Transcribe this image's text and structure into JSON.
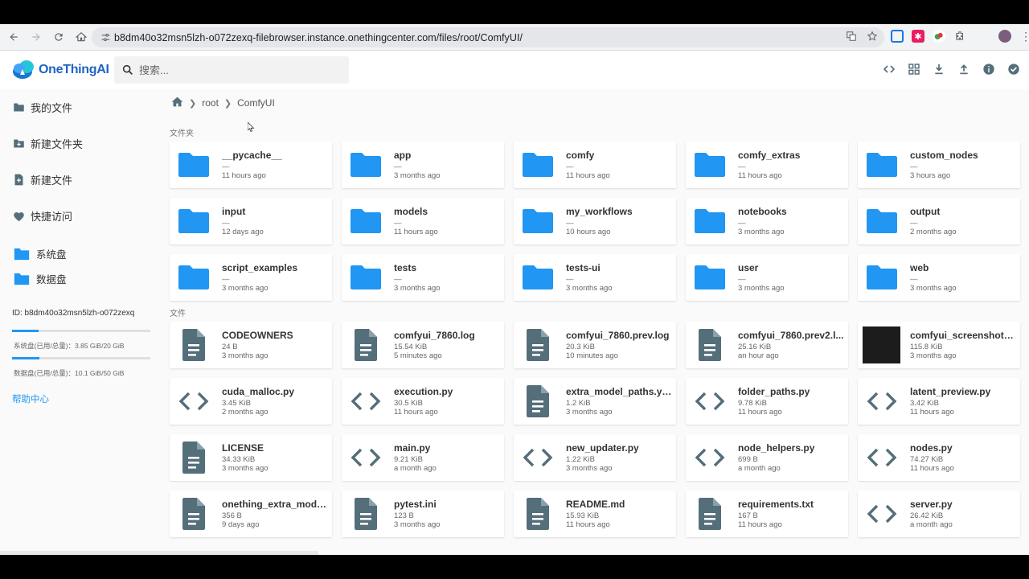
{
  "browser": {
    "url": "b8dm40o32msn5lzh-o072zexq-filebrowser.instance.onethingcenter.com/files/root/ComfyUI/"
  },
  "header": {
    "logo_text": "OneThingAI",
    "search_placeholder": "搜索..."
  },
  "sidebar": {
    "items": [
      {
        "label": "我的文件",
        "icon": "folder-icon"
      },
      {
        "label": "新建文件夹",
        "icon": "folder-plus-icon"
      },
      {
        "label": "新建文件",
        "icon": "file-plus-icon"
      },
      {
        "label": "快捷访问",
        "icon": "heart-icon"
      }
    ],
    "disks": [
      {
        "label": "系统盘"
      },
      {
        "label": "数据盘"
      }
    ],
    "instance_id": "ID: b8dm40o32msn5lzh-o072zexq",
    "usage": [
      {
        "text": "系统盘(已用/总量)：3.85 GiB/20 GiB",
        "fraction": 0.19
      },
      {
        "text": "数据盘(已用/总量)：10.1 GiB/50 GiB",
        "fraction": 0.2
      }
    ],
    "help_label": "帮助中心"
  },
  "breadcrumb": {
    "items": [
      "root",
      "ComfyUI"
    ]
  },
  "sections": {
    "folders_label": "文件夹",
    "files_label": "文件"
  },
  "folders": [
    {
      "name": "__pycache__",
      "size": "—",
      "date": "11 hours ago"
    },
    {
      "name": "app",
      "size": "—",
      "date": "3 months ago"
    },
    {
      "name": "comfy",
      "size": "—",
      "date": "11 hours ago"
    },
    {
      "name": "comfy_extras",
      "size": "—",
      "date": "11 hours ago"
    },
    {
      "name": "custom_nodes",
      "size": "—",
      "date": "3 hours ago"
    },
    {
      "name": "input",
      "size": "—",
      "date": "12 days ago"
    },
    {
      "name": "models",
      "size": "—",
      "date": "11 hours ago"
    },
    {
      "name": "my_workflows",
      "size": "—",
      "date": "10 hours ago"
    },
    {
      "name": "notebooks",
      "size": "—",
      "date": "3 months ago"
    },
    {
      "name": "output",
      "size": "—",
      "date": "2 months ago"
    },
    {
      "name": "script_examples",
      "size": "—",
      "date": "3 months ago"
    },
    {
      "name": "tests",
      "size": "—",
      "date": "3 months ago"
    },
    {
      "name": "tests-ui",
      "size": "—",
      "date": "3 months ago"
    },
    {
      "name": "user",
      "size": "—",
      "date": "3 months ago"
    },
    {
      "name": "web",
      "size": "—",
      "date": "3 months ago"
    }
  ],
  "files": [
    {
      "name": "CODEOWNERS",
      "size": "24 B",
      "date": "3 months ago",
      "type": "doc"
    },
    {
      "name": "comfyui_7860.log",
      "size": "15.54 KiB",
      "date": "5 minutes ago",
      "type": "doc"
    },
    {
      "name": "comfyui_7860.prev.log",
      "size": "20.3 KiB",
      "date": "10 minutes ago",
      "type": "doc"
    },
    {
      "name": "comfyui_7860.prev2.l...",
      "size": "25.16 KiB",
      "date": "an hour ago",
      "type": "doc"
    },
    {
      "name": "comfyui_screenshot.p...",
      "size": "115.8 KiB",
      "date": "3 months ago",
      "type": "image"
    },
    {
      "name": "cuda_malloc.py",
      "size": "3.45 KiB",
      "date": "2 months ago",
      "type": "code"
    },
    {
      "name": "execution.py",
      "size": "30.5 KiB",
      "date": "11 hours ago",
      "type": "code"
    },
    {
      "name": "extra_model_paths.ya...",
      "size": "1.2 KiB",
      "date": "3 months ago",
      "type": "doc"
    },
    {
      "name": "folder_paths.py",
      "size": "9.78 KiB",
      "date": "11 hours ago",
      "type": "code"
    },
    {
      "name": "latent_preview.py",
      "size": "3.42 KiB",
      "date": "11 hours ago",
      "type": "code"
    },
    {
      "name": "LICENSE",
      "size": "34.33 KiB",
      "date": "3 months ago",
      "type": "doc"
    },
    {
      "name": "main.py",
      "size": "9.21 KiB",
      "date": "a month ago",
      "type": "code"
    },
    {
      "name": "new_updater.py",
      "size": "1.22 KiB",
      "date": "3 months ago",
      "type": "code"
    },
    {
      "name": "node_helpers.py",
      "size": "699 B",
      "date": "a month ago",
      "type": "code"
    },
    {
      "name": "nodes.py",
      "size": "74.27 KiB",
      "date": "11 hours ago",
      "type": "code"
    },
    {
      "name": "onething_extra_model...",
      "size": "356 B",
      "date": "9 days ago",
      "type": "doc"
    },
    {
      "name": "pytest.ini",
      "size": "123 B",
      "date": "3 months ago",
      "type": "doc"
    },
    {
      "name": "README.md",
      "size": "15.93 KiB",
      "date": "11 hours ago",
      "type": "doc"
    },
    {
      "name": "requirements.txt",
      "size": "167 B",
      "date": "11 hours ago",
      "type": "doc"
    },
    {
      "name": "server.py",
      "size": "26.42 KiB",
      "date": "a month ago",
      "type": "code"
    }
  ],
  "colors": {
    "accent": "#2196f3",
    "folder": "#2196f3",
    "file_icon": "#546e7a"
  }
}
